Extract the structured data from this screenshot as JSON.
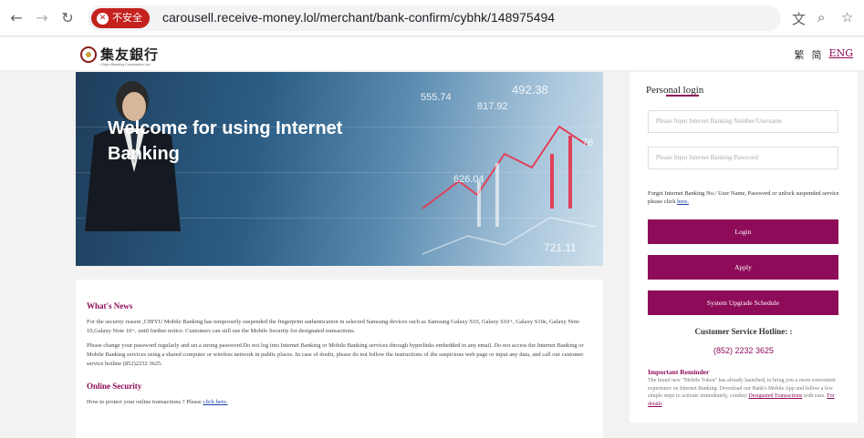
{
  "browser": {
    "back_glyph": "←",
    "forward_glyph": "→",
    "reload_glyph": "↻",
    "security_label": "不安全",
    "url": "carousell.receive-money.lol/merchant/bank-confirm/cybhk/148975494",
    "translate_glyph": "文",
    "zoom_glyph": "⌕",
    "star_glyph": "☆"
  },
  "header": {
    "logo_text": "集友銀行",
    "logo_sub": "Chiyu Banking Corporation Ltd",
    "lang": [
      "繁",
      "简",
      "ENG"
    ]
  },
  "hero": {
    "title": "Welcome for using Internet Banking",
    "numbers": [
      "555.74",
      "492.38",
      "817.92",
      "76",
      "626.04",
      "721.11"
    ]
  },
  "news": {
    "whats_news_title": "What's News",
    "para1": "For the security reason ,CHIYU Mobile Banking has temporarily suspended the fingerprint authentication in selected Samsung devices such as Samsung Galaxy S10, Galaxy S10+, Galaxy S10e, Galaxy Note 10,Galaxy Note 10+, until further notice. Customers can still use the Mobile Security for designated transactions.",
    "para2": "Please change your password regularly and set a strong password.Do not log into Internet Banking or Mobile Banking services through hyperlinks embedded in any email. Do not access the Internet Banking or Mobile Banking services using a shared computer or wireless network in public places. In case of doubt, please do not follow the instructions of the suspicious web page or input any data, and call our customer service hotline (852)2232 3625.",
    "security_title": "Online Security",
    "security_text": "How to protect your online transactions ? Please ",
    "security_link": "click here."
  },
  "login": {
    "title": "Personal login",
    "username_placeholder": "Please Input Internet Banking Number/Username",
    "password_placeholder": "Please Input Internet Banking Password",
    "forgot_text": "Forget Internet Banking No./ User Name, Password or unlock suspended service please click ",
    "forgot_link": "here.",
    "login_button": "Login",
    "apply_button": "Apply",
    "upgrade_button": "System Upgrade Schedule",
    "hotline_label": "Customer Service Hotline: :",
    "hotline_number": "(852) 2232 3625",
    "reminder_title": "Important Reminder",
    "reminder_text": "The brand new \"Mobile Token\" has already launched, to bring you a more convenient experience on Internet Banking. Download our Bank's Mobile App and follow a few simple steps to activate immediately, conduct ",
    "reminder_link1": "Designated Transactions",
    "reminder_mid": " with ease. ",
    "reminder_link2": "For details"
  },
  "colors": {
    "brand": "#8e0b59",
    "insecure": "#c5221f"
  }
}
